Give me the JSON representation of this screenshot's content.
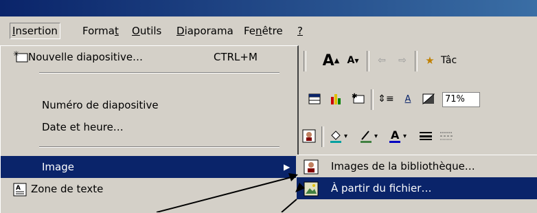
{
  "menubar": {
    "items": [
      {
        "label": "Insertion",
        "underline": "I"
      },
      {
        "label": "Format",
        "underline": "t"
      },
      {
        "label": "Outils",
        "underline": "O"
      },
      {
        "label": "Diaporama",
        "underline": "D"
      },
      {
        "label": "Fenêtre",
        "underline": "n"
      },
      {
        "label": "?",
        "underline": "?"
      }
    ]
  },
  "insert_menu": {
    "items": [
      {
        "label": "Nouvelle diapositive…",
        "shortcut": "CTRL+M",
        "icon": "new-slide-icon"
      },
      {
        "label": "Numéro de diapositive"
      },
      {
        "label": "Date et heure…"
      },
      {
        "label": "Image",
        "submenu": true
      },
      {
        "label": "Zone de texte",
        "icon": "text-box-icon"
      }
    ]
  },
  "image_submenu": {
    "items": [
      {
        "label": "Images de la bibliothèque…",
        "icon": "clipart-icon"
      },
      {
        "label": "À partir du fichier…",
        "icon": "picture-file-icon"
      }
    ]
  },
  "toolbar": {
    "zoom": "71%",
    "task_label": "Tâc"
  },
  "colors": {
    "menu_bg": "#d4d0c8",
    "highlight": "#0a246a",
    "title_bar": "#0a246a"
  }
}
